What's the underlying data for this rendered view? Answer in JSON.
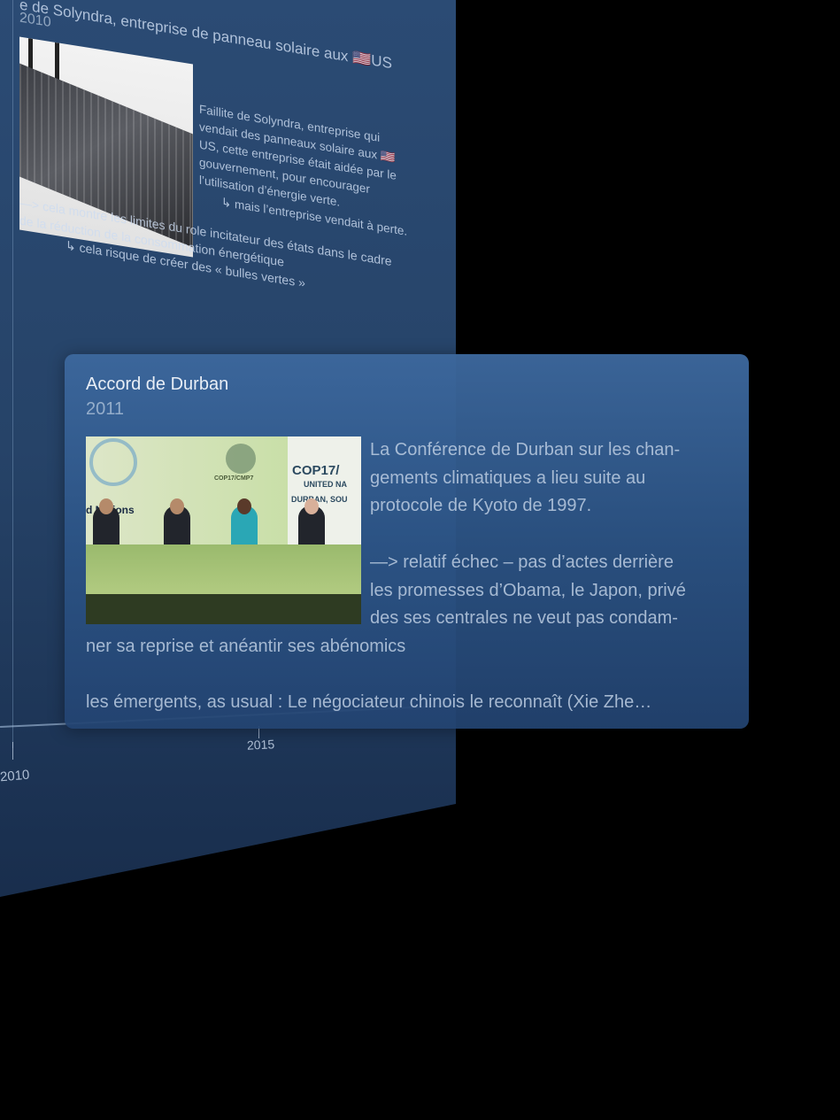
{
  "background_entry": {
    "title": "e de Solyndra, entreprise de panneau solaire aux 🇺🇸US",
    "year": "2010",
    "paragraph": "Faillite de Solyndra, entreprise qui vendait des panneaux solaire aux 🇺🇸US, cette entreprise était aidée par le gouvernement, pour encourager l’utilisation d’énergie verte.",
    "sub_note": "↳ mais l’entreprise vendait à perte.",
    "conclusion": "—> cela montre les limites du role incitateur des états dans le cadre de la réduction de la consommation énergétique",
    "conclusion_sub": "↳ cela risque de créer des « bulles vertes »"
  },
  "timeline": {
    "labels": [
      "2010",
      "2015"
    ]
  },
  "card": {
    "title": "Accord de Durban",
    "year": "2011",
    "photo": {
      "cop": "COP17/CMP7",
      "cop_large": "COP17/",
      "un": "UNITED NA",
      "city": "DURBAN, SOU",
      "nations": "d Nations"
    },
    "para1": [
      "La Conférence de Durban sur les chan-",
      "gements climatiques a lieu suite au",
      "protocole de Kyoto de 1997."
    ],
    "para2": [
      "—>  relatif échec – pas d’actes derrière",
      "les promesses d’Obama, le Japon, privé",
      "des ses centrales ne veut pas condam-"
    ],
    "para2_cont": "ner sa reprise et anéantir ses abénomics",
    "para3": "les émergents, as usual : Le négociateur chinois le reconnaît (Xie Zhe…"
  }
}
